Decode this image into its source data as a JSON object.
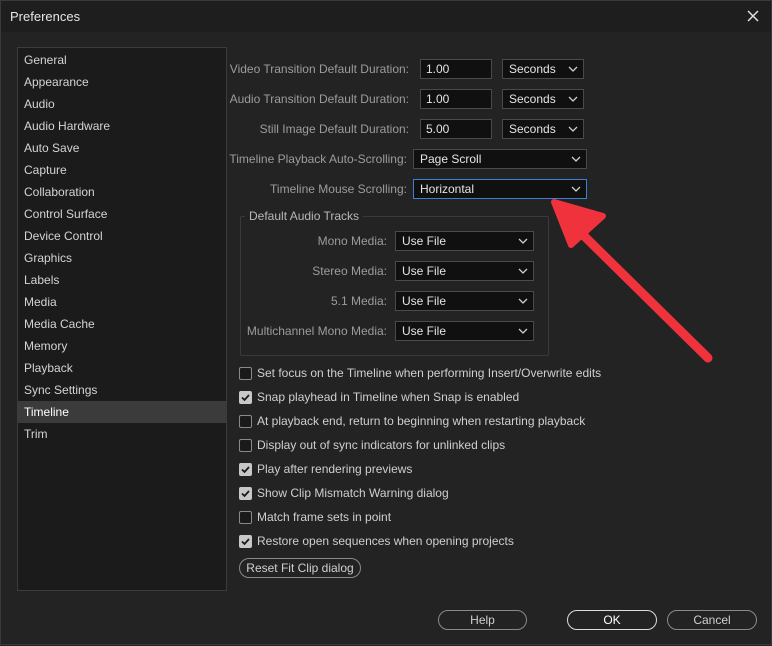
{
  "window": {
    "title": "Preferences"
  },
  "sidebar": {
    "items": [
      {
        "label": "General"
      },
      {
        "label": "Appearance"
      },
      {
        "label": "Audio"
      },
      {
        "label": "Audio Hardware"
      },
      {
        "label": "Auto Save"
      },
      {
        "label": "Capture"
      },
      {
        "label": "Collaboration"
      },
      {
        "label": "Control Surface"
      },
      {
        "label": "Device Control"
      },
      {
        "label": "Graphics"
      },
      {
        "label": "Labels"
      },
      {
        "label": "Media"
      },
      {
        "label": "Media Cache"
      },
      {
        "label": "Memory"
      },
      {
        "label": "Playback"
      },
      {
        "label": "Sync Settings"
      },
      {
        "label": "Timeline"
      },
      {
        "label": "Trim"
      }
    ],
    "selected": "Timeline"
  },
  "durations": {
    "video_transition": {
      "label": "Video Transition Default Duration:",
      "value": "1.00",
      "unit": "Seconds"
    },
    "audio_transition": {
      "label": "Audio Transition Default Duration:",
      "value": "1.00",
      "unit": "Seconds"
    },
    "still_image": {
      "label": "Still Image Default Duration:",
      "value": "5.00",
      "unit": "Seconds"
    }
  },
  "scrolling": {
    "playback_auto": {
      "label": "Timeline Playback Auto-Scrolling:",
      "value": "Page Scroll"
    },
    "mouse": {
      "label": "Timeline Mouse Scrolling:",
      "value": "Horizontal"
    }
  },
  "audio_tracks": {
    "title": "Default Audio Tracks",
    "mono": {
      "label": "Mono Media:",
      "value": "Use File"
    },
    "stereo": {
      "label": "Stereo Media:",
      "value": "Use File"
    },
    "surround": {
      "label": "5.1 Media:",
      "value": "Use File"
    },
    "multichannel": {
      "label": "Multichannel Mono Media:",
      "value": "Use File"
    }
  },
  "checkboxes": [
    {
      "label": "Set focus on the Timeline when performing Insert/Overwrite edits",
      "checked": false
    },
    {
      "label": "Snap playhead in Timeline when Snap is enabled",
      "checked": true
    },
    {
      "label": "At playback end, return to beginning when restarting playback",
      "checked": false
    },
    {
      "label": "Display out of sync indicators for unlinked clips",
      "checked": false
    },
    {
      "label": "Play after rendering previews",
      "checked": true
    },
    {
      "label": "Show Clip Mismatch Warning dialog",
      "checked": true
    },
    {
      "label": "Match frame sets in point",
      "checked": false
    },
    {
      "label": "Restore open sequences when opening projects",
      "checked": true
    }
  ],
  "buttons": {
    "reset_fit_clip": "Reset Fit Clip dialog",
    "help": "Help",
    "ok": "OK",
    "cancel": "Cancel"
  },
  "colors": {
    "annotation_arrow": "#f0323c",
    "focus_border": "#3d7fd6",
    "selected_item": "#3b3b3b"
  },
  "icons": {
    "close": "close-icon",
    "dropdown": "chevron-down-icon",
    "check": "checkmark-icon"
  }
}
